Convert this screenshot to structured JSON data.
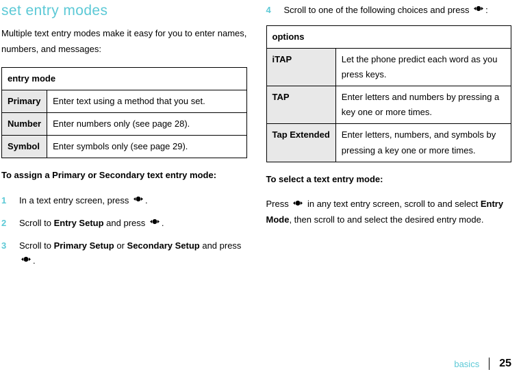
{
  "leftCol": {
    "title": "set entry modes",
    "intro": "Multiple text entry modes make it easy for you to enter names, numbers, and messages:",
    "table": {
      "header": "entry mode",
      "rows": [
        {
          "label": "Primary",
          "desc": "Enter text using a method that you set."
        },
        {
          "label": "Number",
          "desc": "Enter numbers only (see page 28)."
        },
        {
          "label": "Symbol",
          "desc": "Enter symbols only (see page 29)."
        }
      ]
    },
    "assignHeading": "To assign a Primary or Secondary text entry mode:",
    "steps": [
      {
        "num": "1",
        "pre": "In a text entry screen, press ",
        "post": "."
      },
      {
        "num": "2",
        "pre": "Scroll to ",
        "em": "Entry Setup",
        "mid": " and press ",
        "post": "."
      },
      {
        "num": "3",
        "pre": "Scroll to ",
        "em": "Primary Setup",
        "mid": " or ",
        "em2": "Secondary Setup",
        "mid2": " and press ",
        "post": "."
      }
    ]
  },
  "rightCol": {
    "step4": {
      "num": "4",
      "pre": "Scroll to one of the following choices and press ",
      "post": ":"
    },
    "table": {
      "header": "options",
      "rows": [
        {
          "label": "iTAP",
          "desc": "Let the phone predict each word as you press keys."
        },
        {
          "label": "TAP",
          "desc": "Enter letters and numbers by pressing a key one or more times."
        },
        {
          "label": "Tap Extended",
          "desc": "Enter letters, numbers, and symbols by pressing a key one or more times."
        }
      ]
    },
    "selectHeading": "To select a text entry mode:",
    "selectBody": {
      "pre": "Press ",
      "mid": " in any text entry screen, scroll to and select ",
      "em": "Entry Mode",
      "post": ", then scroll to and select the desired entry mode."
    }
  },
  "footer": {
    "label": "basics",
    "page": "25"
  },
  "icons": {
    "nav": "nav-key"
  }
}
